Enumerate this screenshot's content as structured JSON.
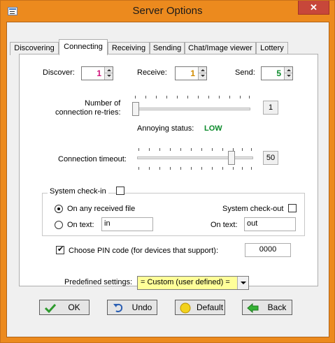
{
  "window": {
    "title": "Server Options",
    "close_glyph": "✕"
  },
  "colors": {
    "frame": "#ec8a1e",
    "close": "#c7473a",
    "status_low": "#0a8a2a",
    "discover_value": "#d0127a",
    "receive_value": "#d18a00",
    "send_value": "#0a8a2a",
    "predefined_bg": "#ffff99"
  },
  "tabs": [
    {
      "label": "Discovering"
    },
    {
      "label": "Connecting"
    },
    {
      "label": "Receiving"
    },
    {
      "label": "Sending"
    },
    {
      "label": "Chat/Image viewer"
    },
    {
      "label": "Lottery"
    }
  ],
  "counts": {
    "discover_label": "Discover:",
    "discover_value": "1",
    "receive_label": "Receive:",
    "receive_value": "1",
    "send_label": "Send:",
    "send_value": "5"
  },
  "retries": {
    "label_line1": "Number of",
    "label_line2": "connection re-tries:",
    "value": "1",
    "annoying_label": "Annoying status:",
    "annoying_value": "LOW"
  },
  "timeout": {
    "label": "Connection timeout:",
    "value": "50"
  },
  "checkin": {
    "label": "System check-in",
    "on_any_label": "On any received file",
    "on_text_label": "On text:",
    "on_text_value": "in",
    "checkout_label": "System check-out",
    "checkout_text_label": "On text:",
    "checkout_text_value": "out"
  },
  "pin": {
    "label": "Choose PIN code (for devices that support):",
    "value": "0000"
  },
  "predefined": {
    "label": "Predefined settings:",
    "value": "= Custom (user defined) ="
  },
  "buttons": {
    "ok": "OK",
    "undo": "Undo",
    "default": "Default",
    "back": "Back"
  },
  "icons": [
    "app-icon",
    "check-icon",
    "undo-icon",
    "default-icon",
    "back-arrow-icon"
  ]
}
